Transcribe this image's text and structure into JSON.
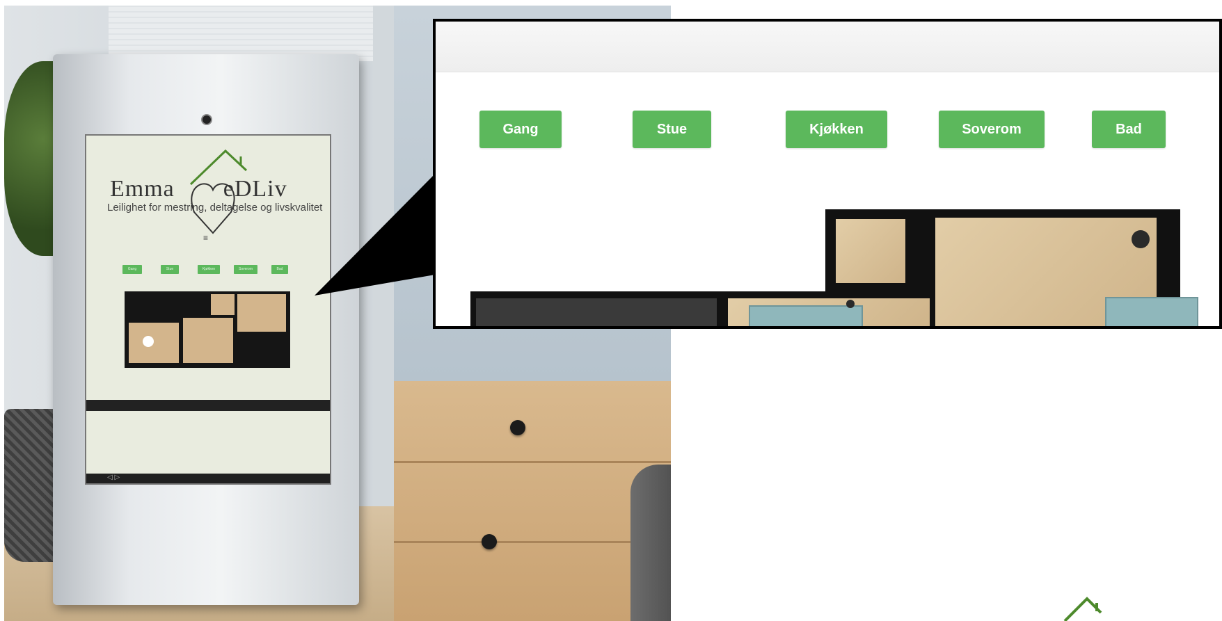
{
  "kiosk_screen": {
    "logo": {
      "name_left": "Emma",
      "name_right": "eDLiv",
      "tagline": "Leilighet for mestring, deltagelse og livskvalitet"
    },
    "menu_icon": "≡",
    "room_buttons": [
      "Gang",
      "Stue",
      "Kjøkken",
      "Soverom",
      "Bad"
    ],
    "nav_icons": "◁ ▷"
  },
  "callout": {
    "room_buttons": [
      "Gang",
      "Stue",
      "Kjøkken",
      "Soverom",
      "Bad"
    ]
  },
  "colors": {
    "button_green": "#5cb85c",
    "logo_green": "#4d8a2c",
    "callout_border": "#000000"
  },
  "icons": [
    "menu-icon",
    "house-heart-logo-icon",
    "back-nav-icon",
    "forward-nav-icon",
    "camera-icon"
  ]
}
